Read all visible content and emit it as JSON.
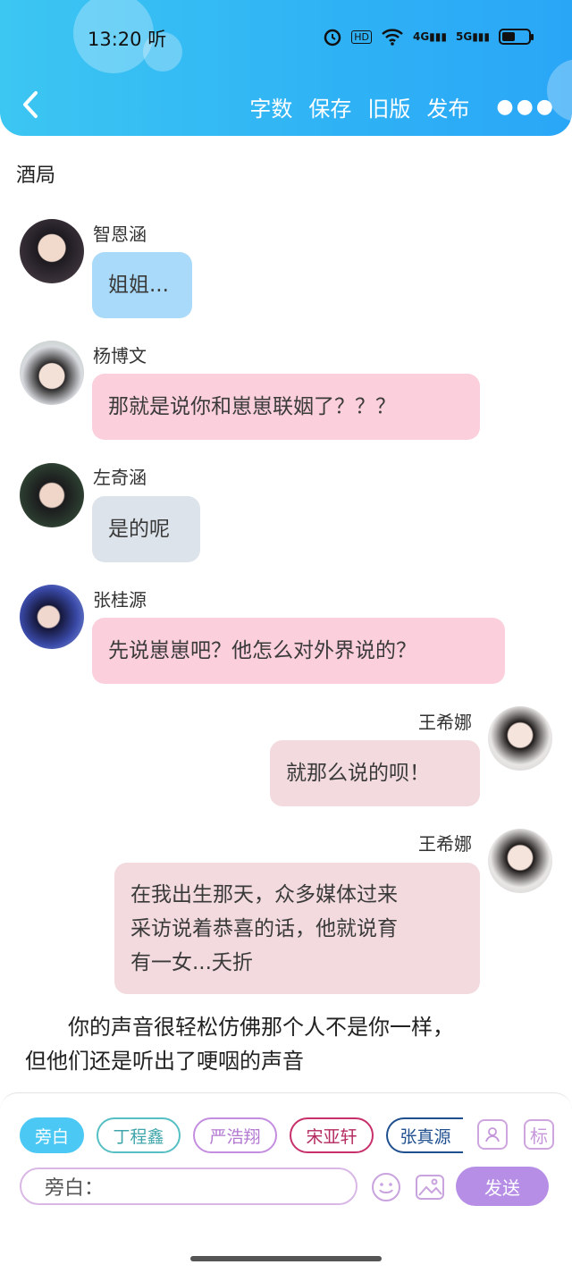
{
  "status": {
    "time": "13:20",
    "extra": "听",
    "hd": "HD",
    "net1": "4G",
    "net2": "5G"
  },
  "nav": {
    "word_count": "字数",
    "save": "保存",
    "old_version": "旧版",
    "publish": "发布"
  },
  "title": "酒局",
  "messages": [
    {
      "name": "智恩涵",
      "text": "姐姐...",
      "side": "left",
      "color": "#a9daf9"
    },
    {
      "name": "杨博文",
      "text": "那就是说你和崽崽联姻了？？？",
      "side": "left",
      "color": "#fbcfdb"
    },
    {
      "name": "左奇涵",
      "text": "是的呢",
      "side": "left",
      "color": "#dde3ea"
    },
    {
      "name": "张桂源",
      "text": "先说崽崽吧？他怎么对外界说的？",
      "side": "left",
      "color": "#fbcfdb"
    },
    {
      "name": "王希娜",
      "text": "就那么说的呗！",
      "side": "right",
      "color": "#f2dade"
    },
    {
      "name": "王希娜",
      "lines": [
        "在我出生那天，众多媒体过来",
        "采访说着恭喜的话，他就说育",
        "有一女...夭折"
      ],
      "side": "right",
      "color": "#f2dade"
    }
  ],
  "narration": {
    "line1": "你的声音很轻松仿佛那个人不是你一样，",
    "line2": "但他们还是听出了哽咽的声音"
  },
  "bottom": {
    "chips": [
      {
        "label": "旁白",
        "color": "#4cc8f4"
      },
      {
        "label": "丁程鑫",
        "color": "#56bfc4"
      },
      {
        "label": "严浩翔",
        "color": "#c48ee0"
      },
      {
        "label": "宋亚轩",
        "color": "#c8306b"
      },
      {
        "label": "张真源",
        "color": "#1f4f8f"
      }
    ],
    "tag_icon": "标",
    "input_placeholder": "旁白：",
    "send_label": "发送"
  }
}
